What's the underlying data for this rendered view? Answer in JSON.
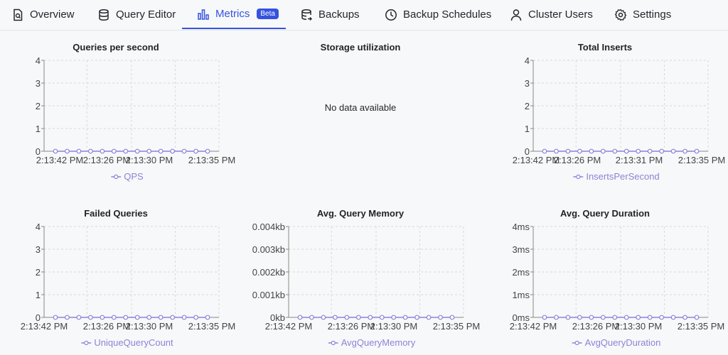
{
  "tabs": [
    {
      "label": "Overview",
      "icon": "document-search-icon",
      "active": false
    },
    {
      "label": "Query Editor",
      "icon": "database-icon",
      "active": false
    },
    {
      "label": "Metrics",
      "icon": "bar-chart-icon",
      "active": true,
      "badge": "Beta"
    },
    {
      "label": "Backups",
      "icon": "database-backup-icon",
      "active": false
    },
    {
      "label": "Backup Schedules",
      "icon": "clock-icon",
      "active": false
    },
    {
      "label": "Cluster Users",
      "icon": "user-icon",
      "active": false
    },
    {
      "label": "Settings",
      "icon": "gear-icon",
      "active": false
    }
  ],
  "colors": {
    "accent": "#3553e0",
    "series": "#8a84d8",
    "grid": "#d9d9d9"
  },
  "charts": {
    "qps": {
      "title": "Queries per second",
      "chart_data": {
        "type": "line",
        "title": "Queries per second",
        "x": [
          "2:13:42 PM",
          "",
          "",
          "",
          "",
          "",
          "",
          "",
          "",
          "",
          "",
          "",
          "",
          ""
        ],
        "x_tick_labels": [
          "2:13:42 PM",
          "2:13:26 PM",
          "2:13:30 PM",
          "2:13:35 PM"
        ],
        "y_tick_labels": [
          "0",
          "1",
          "2",
          "3",
          "4"
        ],
        "ylim": [
          0,
          4
        ],
        "series": [
          {
            "name": "QPS",
            "values": [
              0,
              0,
              0,
              0,
              0,
              0,
              0,
              0,
              0,
              0,
              0,
              0,
              0,
              0
            ]
          }
        ],
        "grid": true,
        "legend": "bottom"
      }
    },
    "storage": {
      "title": "Storage utilization",
      "message": "No data available"
    },
    "inserts": {
      "title": "Total Inserts",
      "chart_data": {
        "type": "line",
        "title": "Total Inserts",
        "x_tick_labels": [
          "2:13:42 PM",
          "2:13:26 PM",
          "2:13:31 PM",
          "2:13:35 PM"
        ],
        "y_tick_labels": [
          "0",
          "1",
          "2",
          "3",
          "4"
        ],
        "ylim": [
          0,
          4
        ],
        "series": [
          {
            "name": "InsertsPerSecond",
            "values": [
              0,
              0,
              0,
              0,
              0,
              0,
              0,
              0,
              0,
              0,
              0,
              0,
              0,
              0
            ]
          }
        ],
        "grid": true,
        "legend": "bottom"
      }
    },
    "failed": {
      "title": "Failed Queries",
      "chart_data": {
        "type": "line",
        "title": "Failed Queries",
        "x_tick_labels": [
          "2:13:42 PM",
          "2:13:26 PM",
          "2:13:30 PM",
          "2:13:35 PM"
        ],
        "y_tick_labels": [
          "0",
          "1",
          "2",
          "3",
          "4"
        ],
        "ylim": [
          0,
          4
        ],
        "series": [
          {
            "name": "UniqueQueryCount",
            "values": [
              0,
              0,
              0,
              0,
              0,
              0,
              0,
              0,
              0,
              0,
              0,
              0,
              0,
              0
            ]
          }
        ],
        "grid": true,
        "legend": "bottom"
      }
    },
    "memory": {
      "title": "Avg. Query Memory",
      "chart_data": {
        "type": "line",
        "title": "Avg. Query Memory",
        "x_tick_labels": [
          "2:13:42 PM",
          "2:13:26 PM",
          "2:13:30 PM",
          "2:13:35 PM"
        ],
        "y_tick_labels": [
          "0kb",
          "0.001kb",
          "0.002kb",
          "0.003kb",
          "0.004kb"
        ],
        "ylim": [
          0,
          0.004
        ],
        "series": [
          {
            "name": "AvgQueryMemory",
            "values": [
              0,
              0,
              0,
              0,
              0,
              0,
              0,
              0,
              0,
              0,
              0,
              0,
              0,
              0
            ]
          }
        ],
        "grid": true,
        "legend": "bottom"
      }
    },
    "duration": {
      "title": "Avg. Query Duration",
      "chart_data": {
        "type": "line",
        "title": "Avg. Query Duration",
        "x_tick_labels": [
          "2:13:42 PM",
          "2:13:26 PM",
          "2:13:30 PM",
          "2:13:35 PM"
        ],
        "y_tick_labels": [
          "0ms",
          "1ms",
          "2ms",
          "3ms",
          "4ms"
        ],
        "ylim": [
          0,
          4
        ],
        "series": [
          {
            "name": "AvgQueryDuration",
            "values": [
              0,
              0,
              0,
              0,
              0,
              0,
              0,
              0,
              0,
              0,
              0,
              0,
              0,
              0
            ]
          }
        ],
        "grid": true,
        "legend": "bottom"
      }
    }
  }
}
